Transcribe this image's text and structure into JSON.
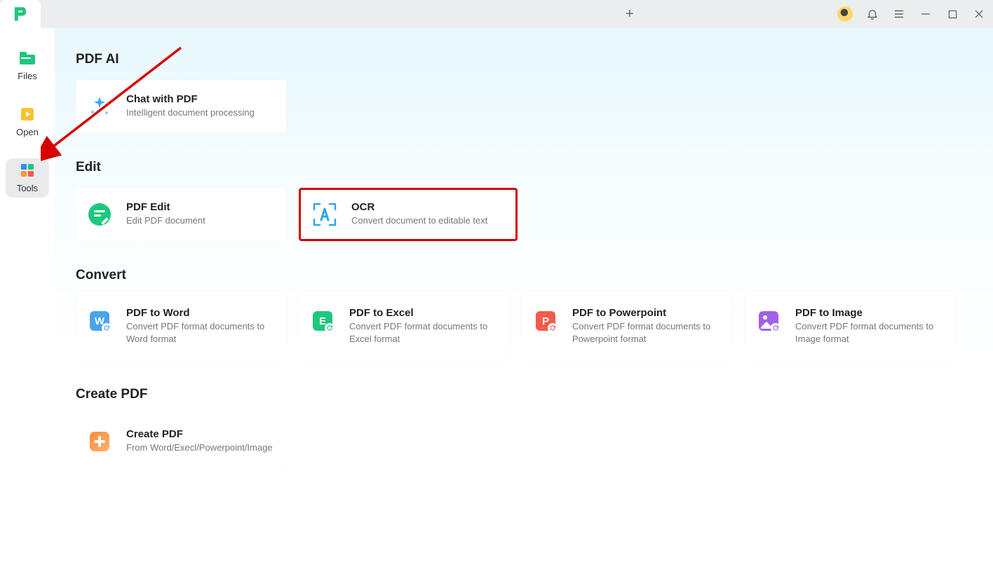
{
  "sidebar": {
    "files": "Files",
    "open": "Open",
    "tools": "Tools"
  },
  "sections": {
    "pdf_ai": {
      "title": "PDF AI",
      "chat": {
        "title": "Chat with PDF",
        "desc": "Intelligent document processing"
      }
    },
    "edit": {
      "title": "Edit",
      "pdf_edit": {
        "title": "PDF Edit",
        "desc": "Edit PDF document"
      },
      "ocr": {
        "title": "OCR",
        "desc": "Convert document to editable text"
      }
    },
    "convert": {
      "title": "Convert",
      "to_word": {
        "title": "PDF to Word",
        "desc": "Convert PDF format documents to Word format"
      },
      "to_excel": {
        "title": "PDF to Excel",
        "desc": "Convert PDF format documents to Excel format"
      },
      "to_ppt": {
        "title": "PDF to Powerpoint",
        "desc": "Convert PDF format documents to Powerpoint format"
      },
      "to_image": {
        "title": "PDF to Image",
        "desc": "Convert PDF format documents to Image format"
      }
    },
    "create": {
      "title": "Create PDF",
      "create_pdf": {
        "title": "Create PDF",
        "desc": "From Word/Execl/Powerpoint/Image"
      }
    }
  }
}
